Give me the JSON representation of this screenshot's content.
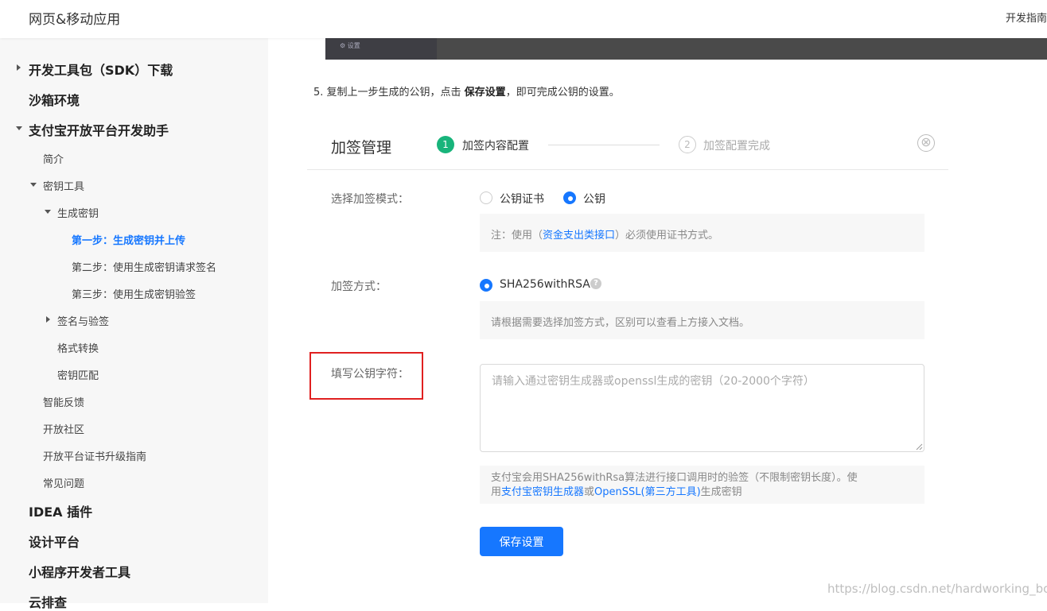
{
  "header": {
    "title": "网页&移动应用",
    "right_link": "开发指南"
  },
  "sidebar": {
    "items": [
      {
        "label": "开发工具包（SDK）下载"
      },
      {
        "label": "沙箱环境"
      },
      {
        "label": "支付宝开放平台开发助手"
      },
      {
        "label": "简介"
      },
      {
        "label": "密钥工具"
      },
      {
        "label": "生成密钥"
      },
      {
        "label": "第一步：生成密钥并上传"
      },
      {
        "label": "第二步：使用生成密钥请求签名"
      },
      {
        "label": "第三步：使用生成密钥验签"
      },
      {
        "label": "签名与验签"
      },
      {
        "label": "格式转换"
      },
      {
        "label": "密钥匹配"
      },
      {
        "label": "智能反馈"
      },
      {
        "label": "开放社区"
      },
      {
        "label": "开放平台证书升级指南"
      },
      {
        "label": "常见问题"
      },
      {
        "label": "IDEA 插件"
      },
      {
        "label": "设计平台"
      },
      {
        "label": "小程序开发者工具"
      },
      {
        "label": "云排查"
      }
    ]
  },
  "content": {
    "prev_image_caption": "⚙ 设置",
    "step": {
      "prefix": "5. 复制上一步生成的公钥，点击 ",
      "bold": "保存设置",
      "suffix": "，即可完成公钥的设置。"
    },
    "panel": {
      "title": "加签管理",
      "steps": [
        {
          "num": "1",
          "label": "加签内容配置"
        },
        {
          "num": "2",
          "label": "加签配置完成"
        }
      ],
      "close_icon": "⊗"
    },
    "form": {
      "mode_label": "选择加签模式：",
      "mode_options": [
        {
          "label": "公钥证书",
          "selected": false
        },
        {
          "label": "公钥",
          "selected": true
        }
      ],
      "mode_note": {
        "prefix": "注：使用（",
        "link": "资金支出类接口",
        "suffix": "）必须使用证书方式。"
      },
      "method_label": "加签方式：",
      "method_option": "SHA256withRSA",
      "method_help": "?",
      "method_note": "请根据需要选择加签方式，区别可以查看上方接入文档。",
      "key_label": "填写公钥字符：",
      "key_placeholder": "请输入通过密钥生成器或openssl生成的密钥（20-2000个字符）",
      "key_value": "",
      "key_note": {
        "line1": "支付宝会用SHA256withRsa算法进行接口调用时的验签（不限制密钥长度）。使",
        "line2_prefix": "用",
        "link1": "支付宝密钥生成器",
        "mid": "或",
        "link2": "OpenSSL(第三方工具)",
        "line2_suffix": "生成密钥"
      },
      "save_label": "保存设置"
    },
    "watermark": "https://blog.csdn.net/hardworking_boy"
  },
  "colors": {
    "accent": "#1677ff",
    "step_active": "#18b47b",
    "highlight_box": "#e02020"
  }
}
